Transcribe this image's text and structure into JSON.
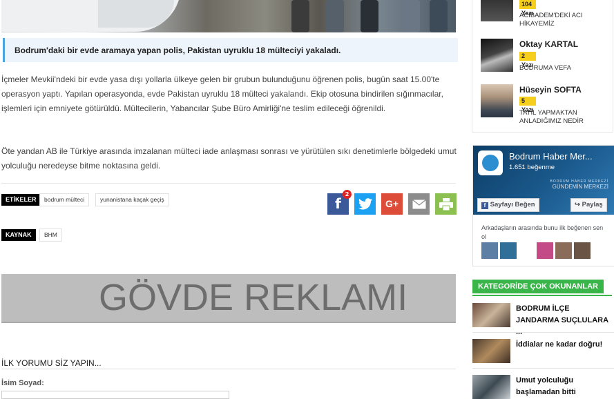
{
  "article": {
    "summary": "Bodrum'daki bir evde aramaya yapan polis, Pakistan uyruklu 18 mülteciyi yakaladı.",
    "paragraph1": "İçmeler Mevkii'ndeki bir evde yasa dışı yollarla ülkeye gelen bir grubun bulunduğunu öğrenen polis, bugün saat 15.00'te operasyon yaptı. Yapılan operasyonda, evde Pakistan uyruklu 18 mülteci yakalandı. Ekip otosuna bindirilen sığınmacılar, işlemleri için emniyete götürüldü. Mültecilerin, Yabancılar Şube Büro Amirliği'ne teslim edileceği öğrenildi.",
    "paragraph2": "Öte yandan AB ile Türkiye arasında imzalanan mülteci iade anlaşması sonrası ve yürütülen sıkı denetimlerle bölgedeki umut yolculuğu neredeyse bitme noktasına geldi."
  },
  "tags": {
    "label": "ETİKELER",
    "items": [
      "bodrum mülteci",
      "yunanistana kaçak geçiş"
    ]
  },
  "source": {
    "label": "KAYNAK",
    "value": "BHM"
  },
  "share": {
    "facebook_count": "2",
    "facebook_glyph": "f",
    "google_glyph": "G+",
    "colors": {
      "facebook": "#3b5998",
      "twitter": "#1da1f2",
      "google": "#dd4b39",
      "email": "#8c8c8c",
      "print": "#8cc152"
    }
  },
  "ad": {
    "text": "GÖVDE REKLAMI"
  },
  "comments": {
    "title": "İLK YORUMU SİZ YAPIN...",
    "name_label": "İsim Soyad:"
  },
  "authors": [
    {
      "count": "104 Yazı",
      "title": "ACIBADEM'DEKİ ACI HİKAYEMİZ"
    },
    {
      "name": "Oktay KARTAL",
      "count": "2 Yazı",
      "title": "BODRUMA VEFA"
    },
    {
      "name": "Hüseyin SOFTA",
      "count": "5 Yazı",
      "title": "TATİL YAPMAKTAN ANLADIĞIMIZ NEDİR"
    }
  ],
  "facebook_box": {
    "page_name": "Bodrum Haber Mer...",
    "likes": "1.651 beğenme",
    "cover_line1": "BODRUM HABER MERKEZİ",
    "cover_line2": "GÜNDEMİN MERKEZİ",
    "like_button": "Sayfayı Beğen",
    "share_button": "Paylaş",
    "friends_text": "Arkadaşların arasında bunu ilk beğenen sen ol"
  },
  "category": {
    "heading": "KATEGORİDE ÇOK OKUNANLAR",
    "items": [
      {
        "title": "BODRUM İLÇE JANDARMA SUÇLULARA ..."
      },
      {
        "title": "İddialar ne kadar doğru!"
      },
      {
        "title": "Umut yolculuğu başlamadan bitti"
      }
    ]
  }
}
